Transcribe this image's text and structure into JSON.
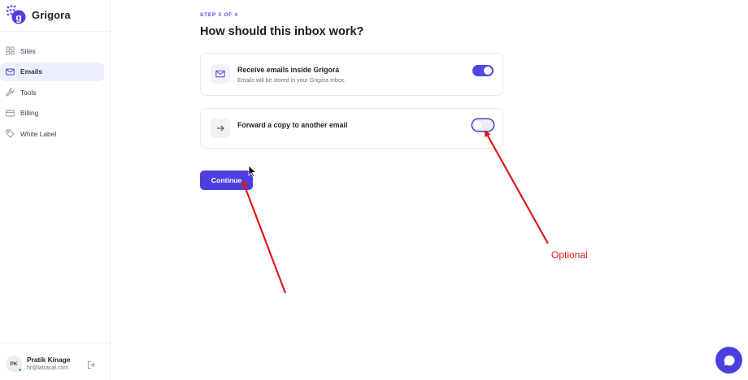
{
  "brand": {
    "name": "Grigora"
  },
  "sidebar": {
    "items": [
      {
        "label": "Sites",
        "icon": "grid-icon",
        "active": false
      },
      {
        "label": "Emails",
        "icon": "mail-icon",
        "active": true
      },
      {
        "label": "Tools",
        "icon": "wrench-icon",
        "active": false
      },
      {
        "label": "Billing",
        "icon": "credit-card-icon",
        "active": false
      },
      {
        "label": "White Label",
        "icon": "tag-icon",
        "active": false
      }
    ]
  },
  "user": {
    "initials": "PK",
    "name": "Pratik Kinage",
    "email": "hr@latracal.com",
    "status_color": "#22c55e"
  },
  "main": {
    "step": "STEP 3 OF 4",
    "title": "How should this inbox work?",
    "options": [
      {
        "title": "Receive emails inside Grigora",
        "description": "Emails will be stored in your Grigora Inbox.",
        "icon": "mail-icon",
        "enabled": true
      },
      {
        "title": "Forward a copy to another email",
        "icon": "arrow-right-icon",
        "enabled": false
      }
    ],
    "continue_label": "Continue"
  },
  "annotation": {
    "label": "Optional",
    "color": "#d81a1a"
  },
  "colors": {
    "accent": "#4b3fe0",
    "active_nav_bg": "#eeeffd"
  }
}
